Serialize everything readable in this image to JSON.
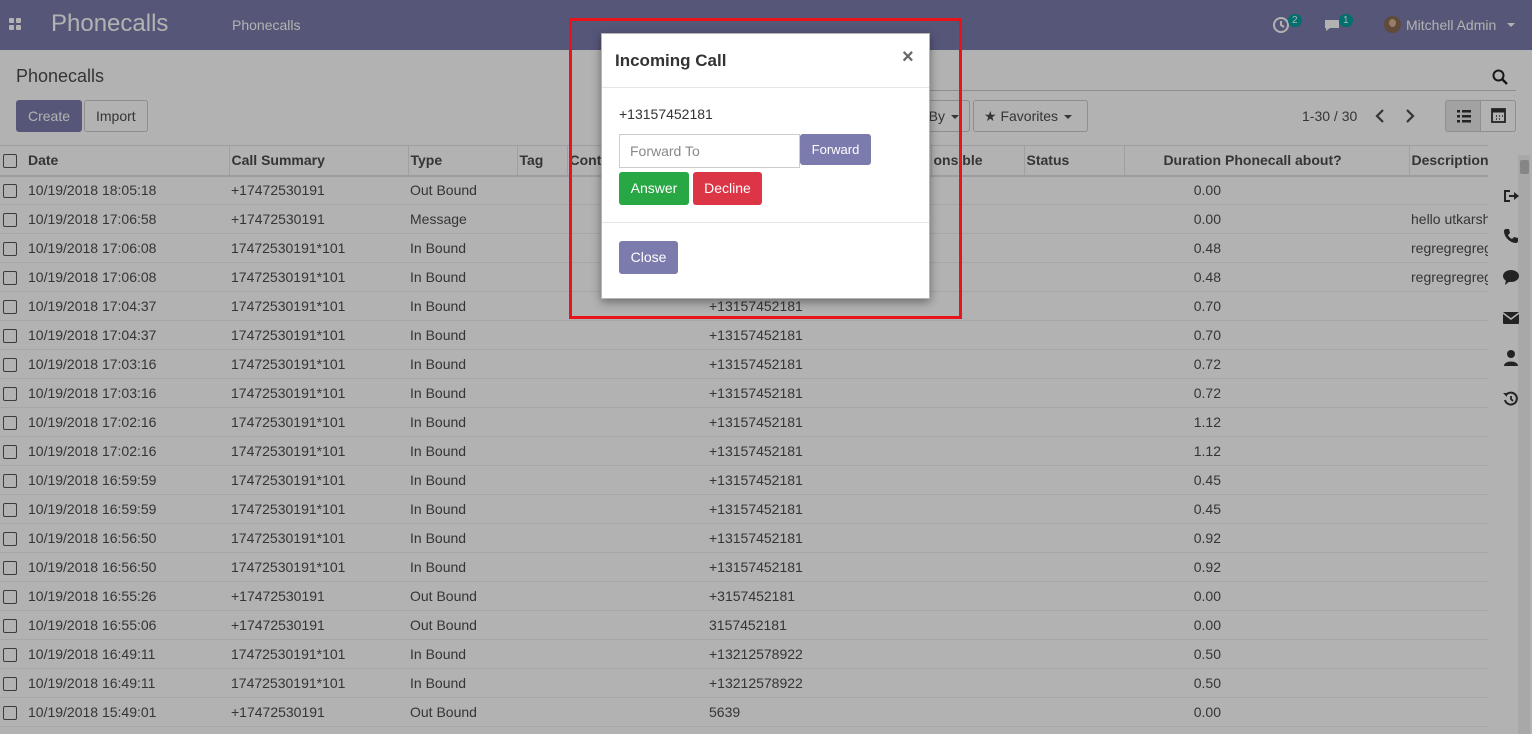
{
  "navbar": {
    "brand": "Phonecalls",
    "menu": "Phonecalls",
    "activity_count": "2",
    "message_count": "1",
    "user_name": "Mitchell Admin",
    "color": "#7c7bad"
  },
  "control_panel": {
    "title": "Phonecalls",
    "create_label": "Create",
    "import_label": "Import",
    "groupby_label": "By",
    "favorites_label": "Favorites",
    "pager": "1-30 / 30"
  },
  "table": {
    "headers": {
      "date": "Date",
      "summary": "Call Summary",
      "type": "Type",
      "tag": "Tag",
      "contact": "Cont",
      "responsible": "onsible",
      "status": "Status",
      "duration": "Duration",
      "about": "Phonecall about?",
      "description": "Description"
    },
    "rows": [
      {
        "date": "10/19/2018 18:05:18",
        "summary": "+17472530191",
        "type": "Out Bound",
        "phone": "",
        "duration": "0.00",
        "description": ""
      },
      {
        "date": "10/19/2018 17:06:58",
        "summary": "+17472530191",
        "type": "Message",
        "phone": "",
        "duration": "0.00",
        "description": "hello utkarsh"
      },
      {
        "date": "10/19/2018 17:06:08",
        "summary": "17472530191*101",
        "type": "In Bound",
        "phone": "",
        "duration": "0.48",
        "description": "regregregreg"
      },
      {
        "date": "10/19/2018 17:06:08",
        "summary": "17472530191*101",
        "type": "In Bound",
        "phone": "",
        "duration": "0.48",
        "description": "regregregreg"
      },
      {
        "date": "10/19/2018 17:04:37",
        "summary": "17472530191*101",
        "type": "In Bound",
        "phone": "+13157452181",
        "duration": "0.70",
        "description": ""
      },
      {
        "date": "10/19/2018 17:04:37",
        "summary": "17472530191*101",
        "type": "In Bound",
        "phone": "+13157452181",
        "duration": "0.70",
        "description": ""
      },
      {
        "date": "10/19/2018 17:03:16",
        "summary": "17472530191*101",
        "type": "In Bound",
        "phone": "+13157452181",
        "duration": "0.72",
        "description": ""
      },
      {
        "date": "10/19/2018 17:03:16",
        "summary": "17472530191*101",
        "type": "In Bound",
        "phone": "+13157452181",
        "duration": "0.72",
        "description": ""
      },
      {
        "date": "10/19/2018 17:02:16",
        "summary": "17472530191*101",
        "type": "In Bound",
        "phone": "+13157452181",
        "duration": "1.12",
        "description": ""
      },
      {
        "date": "10/19/2018 17:02:16",
        "summary": "17472530191*101",
        "type": "In Bound",
        "phone": "+13157452181",
        "duration": "1.12",
        "description": ""
      },
      {
        "date": "10/19/2018 16:59:59",
        "summary": "17472530191*101",
        "type": "In Bound",
        "phone": "+13157452181",
        "duration": "0.45",
        "description": ""
      },
      {
        "date": "10/19/2018 16:59:59",
        "summary": "17472530191*101",
        "type": "In Bound",
        "phone": "+13157452181",
        "duration": "0.45",
        "description": ""
      },
      {
        "date": "10/19/2018 16:56:50",
        "summary": "17472530191*101",
        "type": "In Bound",
        "phone": "+13157452181",
        "duration": "0.92",
        "description": ""
      },
      {
        "date": "10/19/2018 16:56:50",
        "summary": "17472530191*101",
        "type": "In Bound",
        "phone": "+13157452181",
        "duration": "0.92",
        "description": ""
      },
      {
        "date": "10/19/2018 16:55:26",
        "summary": "+17472530191",
        "type": "Out Bound",
        "phone": "+3157452181",
        "duration": "0.00",
        "description": ""
      },
      {
        "date": "10/19/2018 16:55:06",
        "summary": "+17472530191",
        "type": "Out Bound",
        "phone": "3157452181",
        "duration": "0.00",
        "description": ""
      },
      {
        "date": "10/19/2018 16:49:11",
        "summary": "17472530191*101",
        "type": "In Bound",
        "phone": "+13212578922",
        "duration": "0.50",
        "description": ""
      },
      {
        "date": "10/19/2018 16:49:11",
        "summary": "17472530191*101",
        "type": "In Bound",
        "phone": "+13212578922",
        "duration": "0.50",
        "description": ""
      },
      {
        "date": "10/19/2018 15:49:01",
        "summary": "+17472530191",
        "type": "Out Bound",
        "phone": "5639",
        "duration": "0.00",
        "description": ""
      }
    ]
  },
  "modal": {
    "title": "Incoming Call",
    "close_x": "×",
    "caller_number": "+13157452181",
    "forward_placeholder": "Forward To",
    "forward_label": "Forward",
    "answer_label": "Answer",
    "decline_label": "Decline",
    "close_label": "Close",
    "answer_color": "#28a745",
    "decline_color": "#dc3545",
    "highlight_color": "#e8141a"
  },
  "icons": {
    "apps": "apps-grid-icon",
    "activity": "clock-icon",
    "messages": "chat-icon",
    "search": "search-icon",
    "strip": [
      "sign-out-icon",
      "phone-icon",
      "comment-icon",
      "envelope-icon",
      "user-icon",
      "history-icon"
    ]
  }
}
